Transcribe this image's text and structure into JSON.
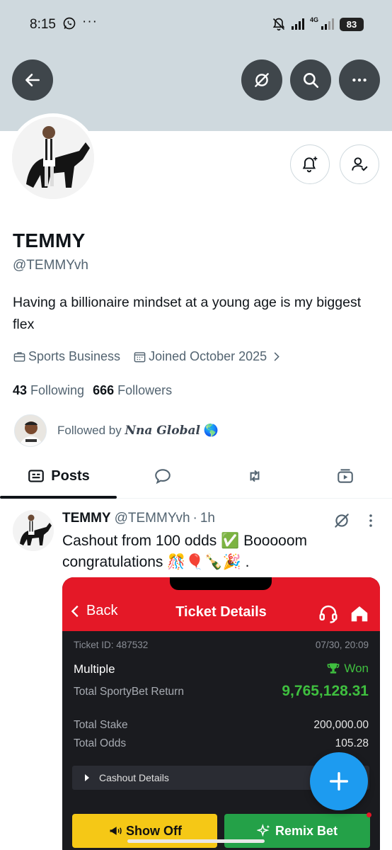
{
  "status_bar": {
    "time": "8:15",
    "dots": "···",
    "network": "4G",
    "battery": "83"
  },
  "profile": {
    "display_name": "TEMMY",
    "handle": "@TEMMYvh",
    "bio": "Having a billionaire mindset at a young age is my biggest flex",
    "category": "Sports Business",
    "joined": "Joined October 2025",
    "following_count": "43",
    "following_label": "Following",
    "followers_count": "666",
    "followers_label": "Followers",
    "followed_by_prefix": "Followed by",
    "followed_by_name": "Nna Global",
    "followed_by_emoji": "🌎"
  },
  "tabs": {
    "posts_label": "Posts"
  },
  "post": {
    "name": "TEMMY",
    "handle": "@TEMMYvh",
    "separator": "·",
    "time": "1h",
    "text_line1": "Cashout from 100 odds ✅ Booooom",
    "text_line2": "congratulations 🎊🎈🍾🎉 ."
  },
  "media": {
    "back_label": "Back",
    "title": "Ticket Details",
    "ticket_id": "Ticket ID: 487532",
    "ticket_date": "07/30, 20:09",
    "bet_type": "Multiple",
    "status": "Won",
    "return_label": "Total SportyBet Return",
    "return_value": "9,765,128.31",
    "stake_label": "Total Stake",
    "stake_value": "200,000.00",
    "odds_label": "Total Odds",
    "odds_value": "105.28",
    "cashout_label": "Cashout Details",
    "show_off_label": "Show Off",
    "remix_label": "Remix Bet"
  },
  "colors": {
    "accent": "#1d9bf0",
    "banner": "#cfd9de",
    "sporty_red": "#e41827",
    "won_green": "#3fbf3f"
  }
}
